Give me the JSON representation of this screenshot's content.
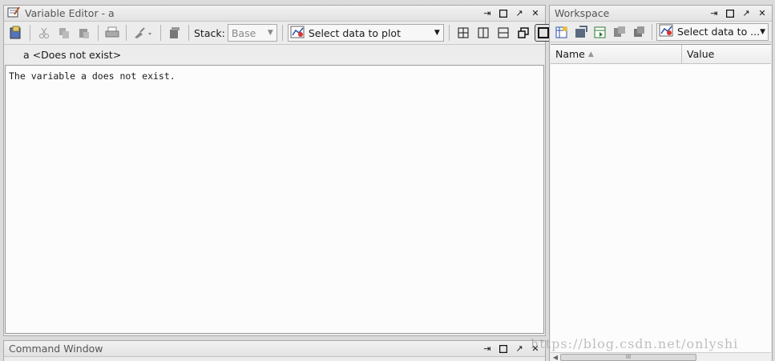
{
  "variable_editor": {
    "title": "Variable Editor - a",
    "toolbar": {
      "stack_label": "Stack:",
      "stack_value": "Base",
      "plot_select": "Select data to plot"
    },
    "tab_label": "a <Does not exist>",
    "message": "The variable a does not exist."
  },
  "workspace": {
    "title": "Workspace",
    "plot_select": "Select data to ...",
    "columns": {
      "name": "Name",
      "value": "Value"
    },
    "scroll_glyph": "III"
  },
  "command_window": {
    "title": "Command Window"
  },
  "watermark": "https://blog.csdn.net/onlyshi",
  "icons": {
    "dock": "dock-icon",
    "maximize": "maximize-icon",
    "undock": "undock-icon",
    "close": "close-icon"
  }
}
